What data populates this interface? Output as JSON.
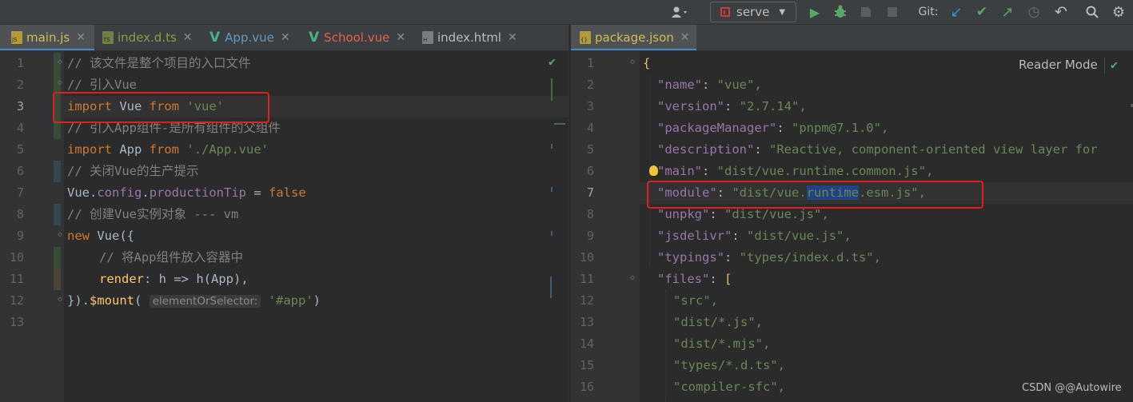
{
  "toolbar": {
    "run_config": "serve",
    "git_label": "Git:"
  },
  "left_tabs": [
    {
      "label": "main.js",
      "color": "#d6b95a",
      "icon_label": "JS",
      "icon_color": "#b39b3a",
      "active": true
    },
    {
      "label": "index.d.ts",
      "color": "#8e9a4b",
      "icon_label": "TS",
      "icon_color": "#4a7aa6",
      "active": false
    },
    {
      "label": "App.vue",
      "color": "#6897bb",
      "icon_label": "V",
      "icon_color": "#41b883",
      "active": false
    },
    {
      "label": "School.vue",
      "color": "#e8614f",
      "icon_label": "V",
      "icon_color": "#41b883",
      "active": false
    },
    {
      "label": "index.html",
      "color": "#bbbbbb",
      "icon_label": "H",
      "icon_color": "#6a8759",
      "active": false
    }
  ],
  "right_tabs": [
    {
      "label": "package.json",
      "color": "#d6b95a",
      "active": true
    }
  ],
  "left_editor": {
    "line_numbers": [
      "1",
      "2",
      "3",
      "4",
      "5",
      "6",
      "7",
      "8",
      "9",
      "10",
      "11",
      "12",
      "13"
    ],
    "comments": {
      "l1": "// 该文件是整个项目的入口文件",
      "l2": "// 引入Vue",
      "l4": "// 引入App组件-是所有组件的父组件",
      "l6": "// 关闭Vue的生产提示",
      "l8": "// 创建Vue实例对象 --- vm",
      "l10": "// 将App组件放入容器中"
    },
    "tokens": {
      "import": "import",
      "vue_ident": "Vue",
      "from": "from",
      "vue_str": "'vue'",
      "app_ident": "App",
      "app_str": "'./App.vue'",
      "dot": ".",
      "config": "config",
      "productionTip": "productionTip",
      "eq_false_op": " = ",
      "false": "false",
      "new": "new",
      "vue_call": "Vue({",
      "render": "render",
      "render_rest": ": h => h(App),",
      "close": "}).",
      "mount": "$mount",
      "paren": "(",
      "hint": "elementOrSelector:",
      "app_sel": "'#app'",
      "close_paren": ")"
    }
  },
  "right_editor": {
    "reader_mode": "Reader Mode",
    "line_numbers": [
      "1",
      "2",
      "3",
      "4",
      "5",
      "6",
      "7",
      "8",
      "9",
      "10",
      "11",
      "12",
      "13",
      "14",
      "15",
      "16"
    ],
    "lines": [
      {
        "k": "",
        "v": "{"
      },
      {
        "k": "\"name\"",
        "v": "\"vue\","
      },
      {
        "k": "\"version\"",
        "v": "\"2.7.14\","
      },
      {
        "k": "\"packageManager\"",
        "v": "\"pnpm@7.1.0\","
      },
      {
        "k": "\"description\"",
        "v": "\"Reactive, component-oriented view layer for"
      },
      {
        "k": "\"main\"",
        "v": "\"dist/vue.runtime.common.js\","
      },
      {
        "k": "\"module\"",
        "v": "\"dist/vue.runtime.esm.js\","
      },
      {
        "k": "\"unpkg\"",
        "v": "\"dist/vue.js\","
      },
      {
        "k": "\"jsdelivr\"",
        "v": "\"dist/vue.js\","
      },
      {
        "k": "\"typings\"",
        "v": "\"types/index.d.ts\","
      },
      {
        "k": "\"files\"",
        "v": "["
      },
      {
        "k": "",
        "v": "\"src\","
      },
      {
        "k": "",
        "v": "\"dist/*.js\","
      },
      {
        "k": "",
        "v": "\"dist/*.mjs\","
      },
      {
        "k": "",
        "v": "\"types/*.d.ts\","
      },
      {
        "k": "",
        "v": "\"compiler-sfc\","
      }
    ],
    "module_line": {
      "key": "\"module\"",
      "sep": ": ",
      "v1": "\"dist/vue.",
      "v_sel": "runtime",
      "v2": ".esm.js\","
    }
  },
  "watermark": "CSDN @@Autowire"
}
